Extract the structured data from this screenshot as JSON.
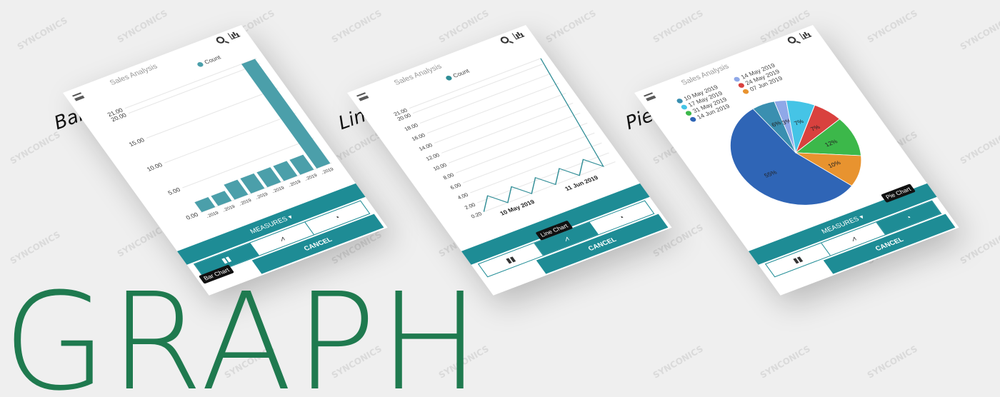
{
  "watermark": "SYNCONICS",
  "big_title": "GRAPH",
  "colors": {
    "teal": "#1e8c95",
    "bar": "#4b9faa",
    "line": "#2f8d96",
    "title_green": "#1f7a4f"
  },
  "screens": [
    {
      "heading": "Bar Chart",
      "subtitle": "Sales Analysis",
      "legend": "Count",
      "measures_label": "MEASURES ▾",
      "cancel_label": "CANCEL",
      "tooltip": "Bar Chart",
      "chart_data": {
        "type": "bar",
        "title": "Sales Analysis",
        "y_ticks": [
          "0.00",
          "5.00",
          "10.00",
          "15.00",
          "20.00",
          "21.00"
        ],
        "ylim": [
          0,
          21
        ],
        "categories": [
          "..2019",
          "..2019",
          "..2019",
          "..2019",
          "..2019",
          "..2019",
          "..2019",
          "..2019"
        ],
        "series": [
          {
            "name": "Count",
            "values": [
              2,
              2,
              3,
              3,
              3,
              3,
              3,
              21
            ]
          }
        ]
      }
    },
    {
      "heading": "Line Chart",
      "subtitle": "Sales Analysis",
      "legend": "Count",
      "measures_label": "",
      "cancel_label": "CANCEL",
      "tooltip": "Line Chart",
      "chart_data": {
        "type": "line",
        "title": "Sales Analysis",
        "y_ticks": [
          "0.20",
          "2.00",
          "4.00",
          "6.00",
          "8.00",
          "10.00",
          "12.00",
          "14.00",
          "16.00",
          "18.00",
          "20.00",
          "21.00"
        ],
        "ylim": [
          0,
          21
        ],
        "x_ticks": [
          "10 May 2019",
          "11 Jun 2019"
        ],
        "series": [
          {
            "name": "Count",
            "values": [
              0.2,
              2.5,
              0.2,
              2.5,
              0.2,
              2.5,
              0.2,
              2.5,
              0.2,
              2.5,
              0.2,
              21
            ]
          }
        ]
      }
    },
    {
      "heading": "Pie Chart",
      "subtitle": "Sales Analysis",
      "measures_label": "MEASURES ▾",
      "cancel_label": "CANCEL",
      "tooltip": "Pie Chart",
      "legend_items": [
        {
          "label": "10 May 2019",
          "color": "#3a8fb0"
        },
        {
          "label": "14 May 2019",
          "color": "#8fa8e8"
        },
        {
          "label": "17 May 2019",
          "color": "#45c4e6"
        },
        {
          "label": "24 May 2019",
          "color": "#d9413e"
        },
        {
          "label": "31 May 2019",
          "color": "#3cb84a"
        },
        {
          "label": "07 Jun 2019",
          "color": "#e8932f"
        },
        {
          "label": "14 Jun 2019",
          "color": "#2f65b6"
        }
      ],
      "chart_data": {
        "type": "pie",
        "title": "Sales Analysis",
        "slices": [
          {
            "label": "14 Jun 2019",
            "value": 55,
            "text": "55%"
          },
          {
            "label": "10 May 2019",
            "value": 6,
            "text": "6%"
          },
          {
            "label": "14 May 2019",
            "value": 3,
            "text": "3%"
          },
          {
            "label": "17 May 2019",
            "value": 7,
            "text": "7%"
          },
          {
            "label": "24 May 2019",
            "value": 7,
            "text": "7%"
          },
          {
            "label": "31 May 2019",
            "value": 12,
            "text": "12%"
          },
          {
            "label": "07 Jun 2019",
            "value": 10,
            "text": "10%"
          }
        ]
      }
    }
  ]
}
